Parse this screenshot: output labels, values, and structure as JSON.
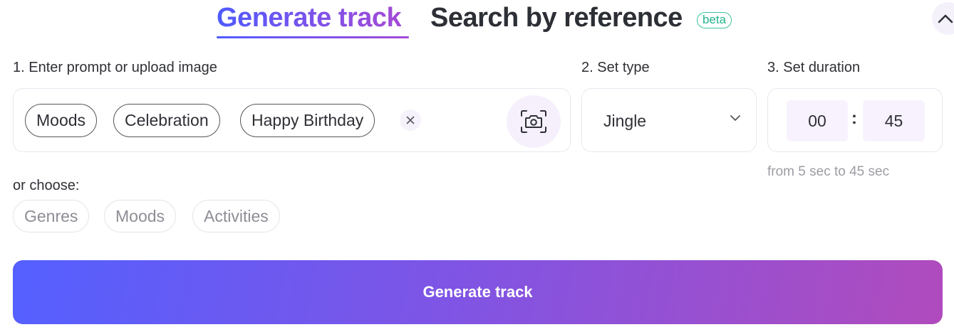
{
  "tabs": {
    "generate_label": "Generate track",
    "search_label": "Search by reference",
    "beta_badge": "beta"
  },
  "prompt": {
    "label": "1. Enter prompt or upload image",
    "chips": [
      "Moods",
      "Celebration",
      "Happy Birthday"
    ]
  },
  "type": {
    "label": "2. Set type",
    "value": "Jingle"
  },
  "duration": {
    "label": "3. Set duration",
    "minutes": "00",
    "separator": ":",
    "seconds": "45",
    "hint": "from 5 sec to 45 sec"
  },
  "choose": {
    "label": "or choose:",
    "options": [
      "Genres",
      "Moods",
      "Activities"
    ]
  },
  "generate_button": {
    "label": "Generate track"
  },
  "colors": {
    "accent_start": "#4f5bff",
    "accent_end": "#b04bbd",
    "beta": "#23b38c"
  },
  "icons": [
    "chevron-up-icon",
    "close-icon",
    "camera-icon",
    "chevron-down-icon"
  ]
}
